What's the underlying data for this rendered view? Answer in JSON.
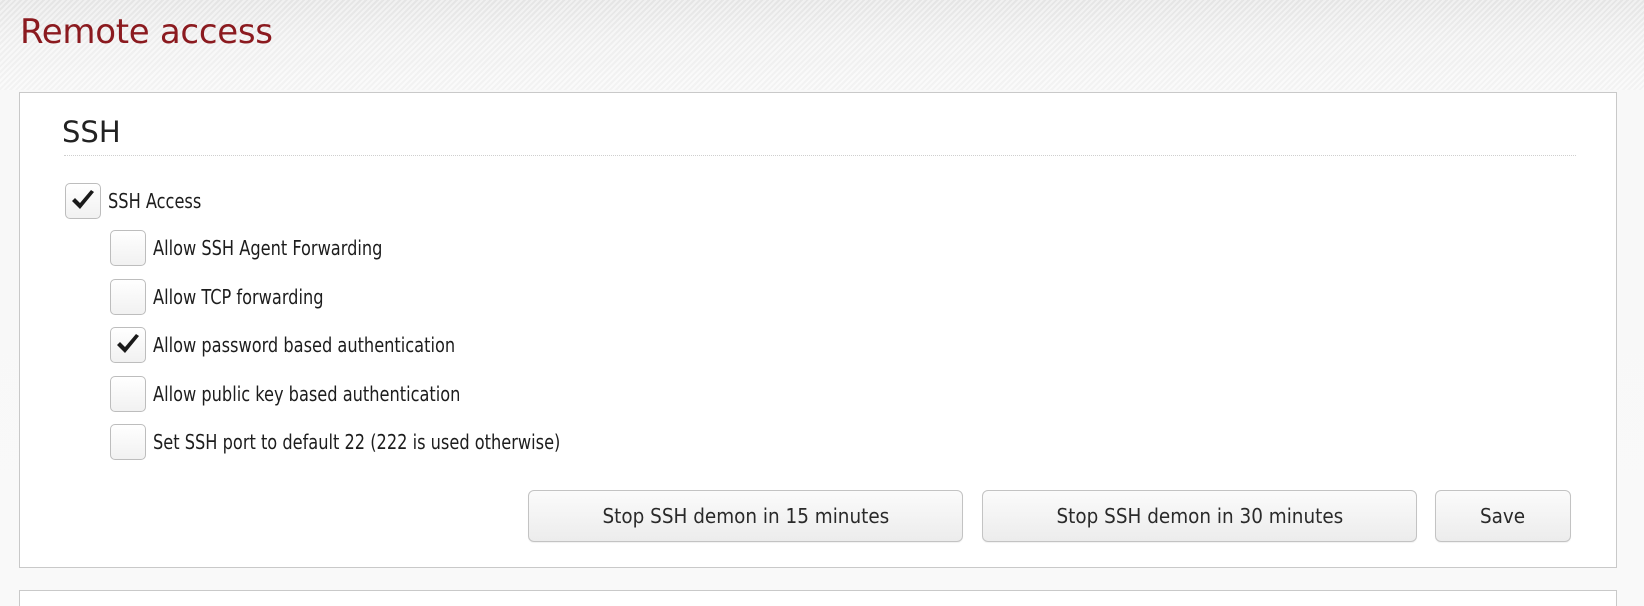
{
  "page": {
    "title": "Remote access"
  },
  "ssh": {
    "title": "SSH",
    "access": {
      "label": "SSH Access",
      "checked": true
    },
    "options": [
      {
        "label": "Allow SSH Agent Forwarding",
        "checked": false
      },
      {
        "label": "Allow TCP forwarding",
        "checked": false
      },
      {
        "label": "Allow password based authentication",
        "checked": true
      },
      {
        "label": "Allow public key based authentication",
        "checked": false
      },
      {
        "label": "Set SSH port to default 22 (222 is used otherwise)",
        "checked": false
      }
    ],
    "buttons": {
      "stop15": "Stop SSH demon in 15 minutes",
      "stop30": "Stop SSH demon in 30 minutes",
      "save": "Save"
    }
  },
  "icons": {
    "check": "checkmark-icon"
  },
  "colors": {
    "title": "#8b1a1f",
    "check": "#1a1a1a"
  }
}
